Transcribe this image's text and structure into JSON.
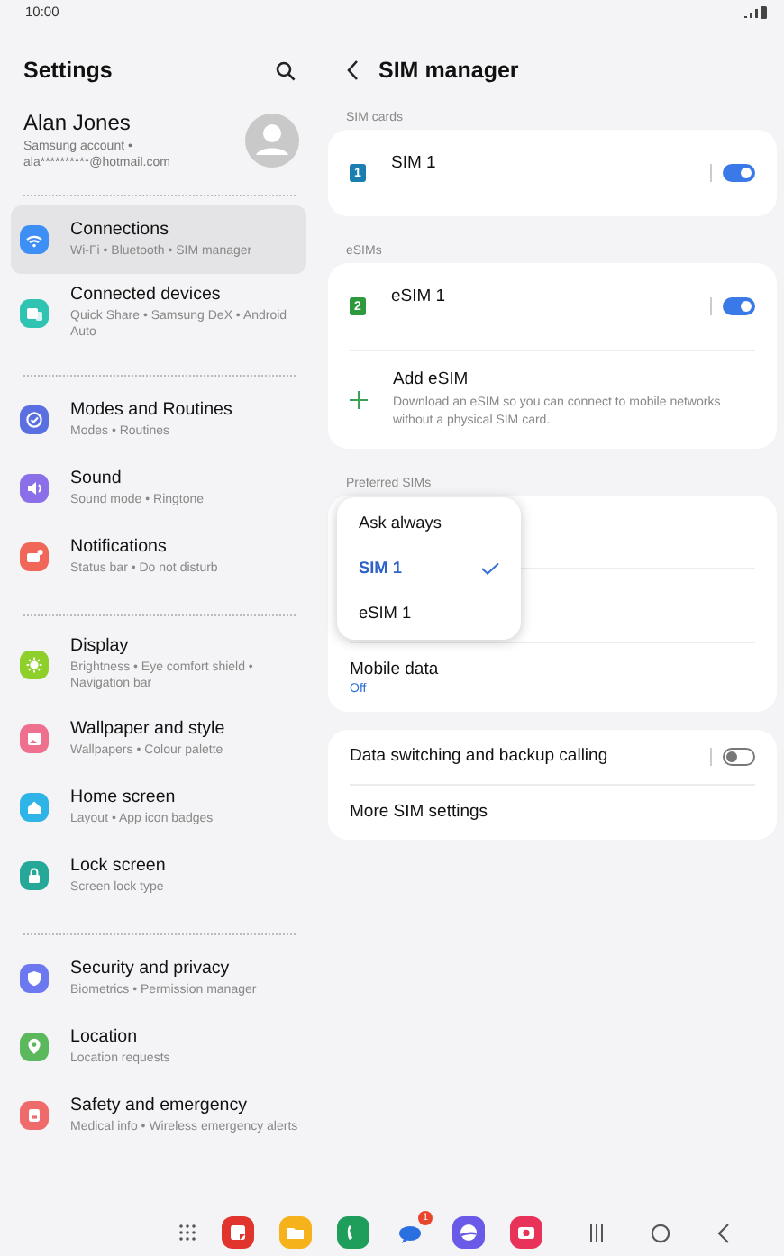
{
  "status_bar": {
    "time": "10:00"
  },
  "settings_pane": {
    "title": "Settings",
    "profile": {
      "name": "Alan Jones",
      "detail": "Samsung account •\nala**********@hotmail.com"
    },
    "groups": [
      [
        {
          "title": "Connections",
          "subtitle": "Wi-Fi  •  Bluetooth  •  SIM manager",
          "color": "#3d8ef5",
          "selected": true
        },
        {
          "title": "Connected devices",
          "subtitle": "Quick Share  •  Samsung DeX  •  Android Auto",
          "color": "#2fc4b2",
          "selected": false
        }
      ],
      [
        {
          "title": "Modes and Routines",
          "subtitle": "Modes  •  Routines",
          "color": "#5a6fe0",
          "selected": false
        },
        {
          "title": "Sound",
          "subtitle": "Sound mode  •  Ringtone",
          "color": "#8a6fe8",
          "selected": false
        },
        {
          "title": "Notifications",
          "subtitle": "Status bar  •  Do not disturb",
          "color": "#f0675a",
          "selected": false
        }
      ],
      [
        {
          "title": "Display",
          "subtitle": "Brightness  •  Eye comfort shield  •  Navigation bar",
          "color": "#8fcf2a",
          "selected": false
        },
        {
          "title": "Wallpaper and style",
          "subtitle": "Wallpapers  •  Colour palette",
          "color": "#ef6f8f",
          "selected": false
        },
        {
          "title": "Home screen",
          "subtitle": "Layout  •  App icon badges",
          "color": "#2eb4e6",
          "selected": false
        },
        {
          "title": "Lock screen",
          "subtitle": "Screen lock type",
          "color": "#25a898",
          "selected": false
        }
      ],
      [
        {
          "title": "Security and privacy",
          "subtitle": "Biometrics  •  Permission manager",
          "color": "#6b78f0",
          "selected": false
        },
        {
          "title": "Location",
          "subtitle": "Location requests",
          "color": "#5cb85c",
          "selected": false
        },
        {
          "title": "Safety and emergency",
          "subtitle": "Medical info  •  Wireless emergency alerts",
          "color": "#ef6a6a",
          "selected": false
        }
      ]
    ]
  },
  "sim_pane": {
    "title": "SIM manager",
    "sections": [
      {
        "label": "SIM cards",
        "rows": [
          {
            "kind": "sim",
            "title": "SIM 1",
            "badge": "1",
            "color": "#1a7fb0",
            "on": true
          }
        ]
      },
      {
        "label": "eSIMs",
        "rows": [
          {
            "kind": "sim",
            "title": "eSIM 1",
            "badge": "2",
            "color": "#2e9a3e",
            "on": true
          },
          {
            "kind": "add",
            "title": "Add eSIM",
            "subtitle": "Download an eSIM so you can connect to mobile networks without a physical SIM card."
          }
        ]
      },
      {
        "label": "Preferred SIMs",
        "rows": [
          {
            "kind": "hidden"
          },
          {
            "kind": "hidden"
          },
          {
            "kind": "value",
            "title": "Mobile data",
            "value": "Off"
          }
        ]
      },
      {
        "rows": [
          {
            "kind": "switch",
            "title": "Data switching and backup calling",
            "on": false
          },
          {
            "kind": "plain",
            "title": "More SIM settings"
          }
        ]
      }
    ],
    "menu": [
      {
        "label": "Ask always",
        "selected": false
      },
      {
        "label": "SIM 1",
        "selected": true
      },
      {
        "label": "eSIM 1",
        "selected": false
      }
    ]
  },
  "nav_bar": {
    "apps": [
      {
        "color": "#e0342c"
      },
      {
        "color": "#f5b21b"
      },
      {
        "color": "#1e9e5a"
      },
      {
        "color": "#2a6fe0",
        "badge": "1"
      },
      {
        "color": "#6a5ae8"
      },
      {
        "color": "#e8325a"
      }
    ]
  }
}
